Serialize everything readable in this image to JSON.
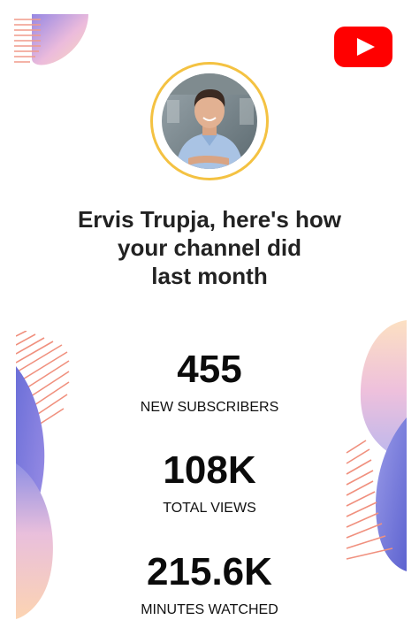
{
  "brand": {
    "logo_icon": "youtube-play-icon",
    "logo_red": "#ff0000",
    "ring_color": "#f4c242"
  },
  "profile": {
    "avatar_icon": "profile-photo"
  },
  "headline": {
    "line1": "Ervis Trupja, here's how",
    "line2": "your channel did",
    "line3": "last month"
  },
  "stats": [
    {
      "value": "455",
      "label": "NEW SUBSCRIBERS"
    },
    {
      "value": "108K",
      "label": "TOTAL VIEWS"
    },
    {
      "value": "215.6K",
      "label": "MINUTES WATCHED"
    }
  ]
}
